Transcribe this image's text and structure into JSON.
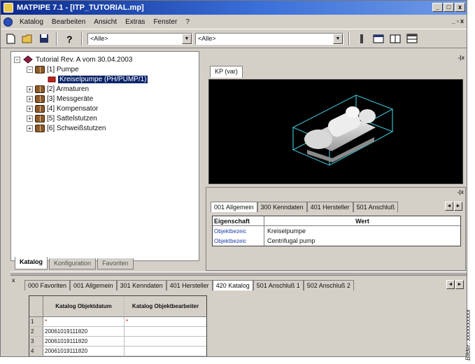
{
  "window": {
    "title": "MATPIPE 7.1 - [ITP_TUTORIAL.mp]",
    "controls": [
      "_",
      "□",
      "x"
    ]
  },
  "menubar": {
    "items": [
      "Katalog",
      "Bearbeiten",
      "Ansicht",
      "Extras",
      "Fenster",
      "?"
    ]
  },
  "toolbar": {
    "combo1_value": "<Alle>",
    "combo2_value": "<Alle>"
  },
  "tree": {
    "root": "Tutorial Rev. A vom 30.04.2003",
    "items": [
      {
        "label": "[1] Pumpe",
        "expanded": true
      },
      {
        "label": "Kreiselpumpe (PH/PUMP/1)",
        "selected": true
      },
      {
        "label": "[2] Armaturen"
      },
      {
        "label": "[3] Messgeräte"
      },
      {
        "label": "[4] Kompensator"
      },
      {
        "label": "[5] Sattelstutzen"
      },
      {
        "label": "[6] Schweißstutzen"
      }
    ]
  },
  "left_tabs": [
    "Katalog",
    "Konfiguration",
    "Favoriten"
  ],
  "viewer": {
    "tab_label": "KP (var)"
  },
  "properties": {
    "tabs": [
      "001 Allgemein",
      "300 Kenndaten",
      "401 Hersteller",
      "501 Anschluß"
    ],
    "header": {
      "col1": "Eigenschaft",
      "col2": "Wert"
    },
    "rows": [
      {
        "name": "Objektbezeic",
        "value": "Kreiselpumpe"
      },
      {
        "name": "Objektbezeic",
        "value": "Centrifugal pump"
      }
    ]
  },
  "bottom": {
    "tabs": [
      "000 Favoriten",
      "001 Allgemein",
      "301 Kenndaten",
      "401 Hersteller",
      "420 Katalog",
      "501 Anschluß 1",
      "502 Anschluß 2"
    ],
    "active_tab": "420 Katalog",
    "columns": [
      "Katalog Objektdatum",
      "Katalog Objektbearbeiter"
    ],
    "rows": [
      {
        "num": "1",
        "date": "*",
        "user": "*"
      },
      {
        "num": "2",
        "date": "20061019111820",
        "user": ""
      },
      {
        "num": "3",
        "date": "20061019111820",
        "user": ""
      },
      {
        "num": "4",
        "date": "20061019111820",
        "user": ""
      }
    ]
  },
  "credit": "Bilder: xxxxxxxxxx"
}
